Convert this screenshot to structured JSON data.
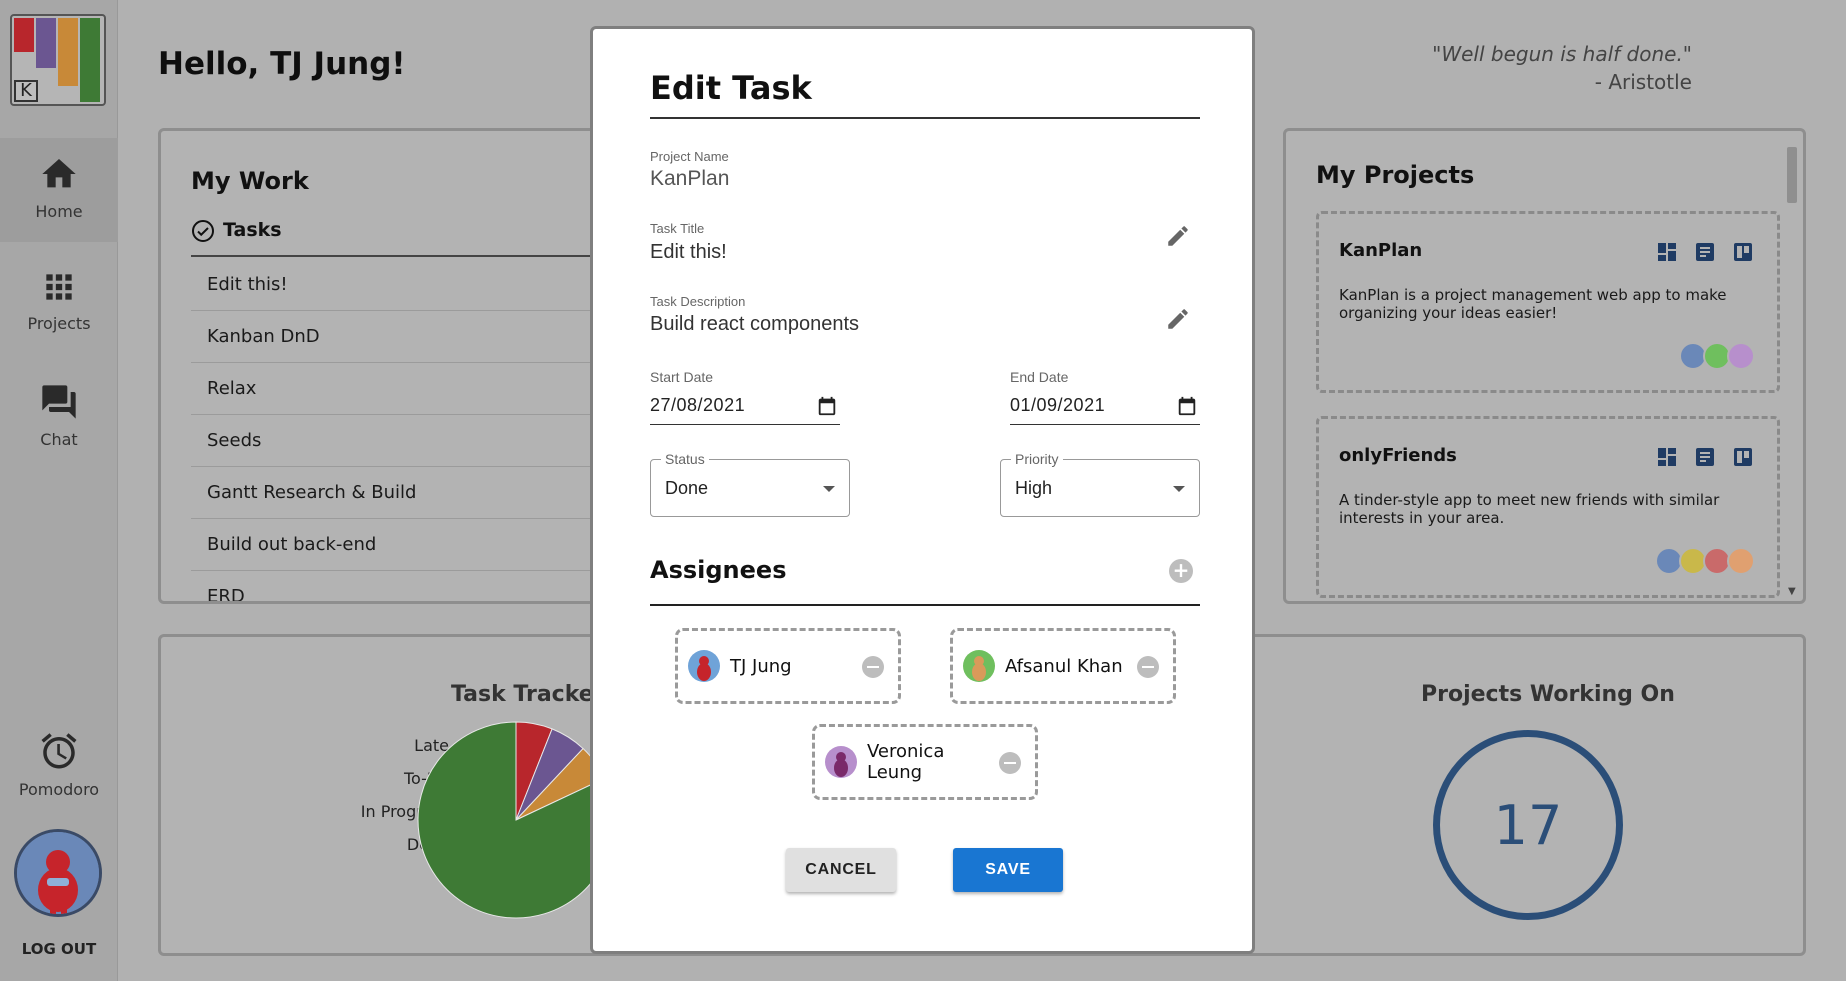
{
  "header": {
    "greeting": "Hello, TJ Jung!",
    "quote": "\"Well begun is half done.\"",
    "quote_author": "- Aristotle"
  },
  "sidebar": {
    "logo_letter": "K",
    "items": [
      {
        "label": "Home",
        "icon": "home-icon"
      },
      {
        "label": "Projects",
        "icon": "grid-icon"
      },
      {
        "label": "Chat",
        "icon": "chat-icon"
      },
      {
        "label": "Pomodoro",
        "icon": "alarm-clock-icon"
      }
    ],
    "logout_label": "LOG OUT"
  },
  "my_work": {
    "title": "My Work",
    "tab_label": "Tasks",
    "tasks": [
      "Edit this!",
      "Kanban DnD",
      "Relax",
      "Seeds",
      "Gantt Research & Build",
      "Build out back-end",
      "ERD"
    ]
  },
  "my_projects": {
    "title": "My Projects",
    "projects": [
      {
        "name": "KanPlan",
        "description": "KanPlan is a project management web app to make organizing your ideas easier!"
      },
      {
        "name": "onlyFriends",
        "description": "A tinder-style app to meet new friends with similar interests in your area."
      }
    ]
  },
  "task_tracker": {
    "title": "Task Tracker",
    "legend": [
      {
        "label": "Late",
        "color": "#b8262c"
      },
      {
        "label": "To-Do",
        "color": "#6b5691"
      },
      {
        "label": "In Progress",
        "color": "#c88938"
      },
      {
        "label": "Done",
        "color": "#3e7a35"
      }
    ]
  },
  "chart_data": {
    "type": "pie",
    "title": "Task Tracker",
    "categories": [
      "Late",
      "To-Do",
      "In Progress",
      "Done"
    ],
    "values": [
      6,
      6,
      6,
      82
    ],
    "colors": [
      "#b8262c",
      "#6b5691",
      "#c88938",
      "#3e7a35"
    ]
  },
  "projects_working_on": {
    "title": "Projects Working On",
    "count": "17"
  },
  "modal": {
    "title": "Edit Task",
    "project_name_label": "Project Name",
    "project_name": "KanPlan",
    "task_title_label": "Task Title",
    "task_title": "Edit this!",
    "task_description_label": "Task Description",
    "task_description": "Build react components",
    "start_date_label": "Start Date",
    "start_date": "27/08/2021",
    "end_date_label": "End Date",
    "end_date": "01/09/2021",
    "status_label": "Status",
    "status_value": "Done",
    "priority_label": "Priority",
    "priority_value": "High",
    "assignees_title": "Assignees",
    "assignees": [
      {
        "name": "TJ Jung",
        "avatar_color": "#6fa3d8"
      },
      {
        "name": "Afsanul Khan",
        "avatar_color": "#6fbf5e"
      },
      {
        "name": "Veronica Leung",
        "avatar_color": "#b78fcc"
      }
    ],
    "cancel_label": "CANCEL",
    "save_label": "SAVE"
  }
}
